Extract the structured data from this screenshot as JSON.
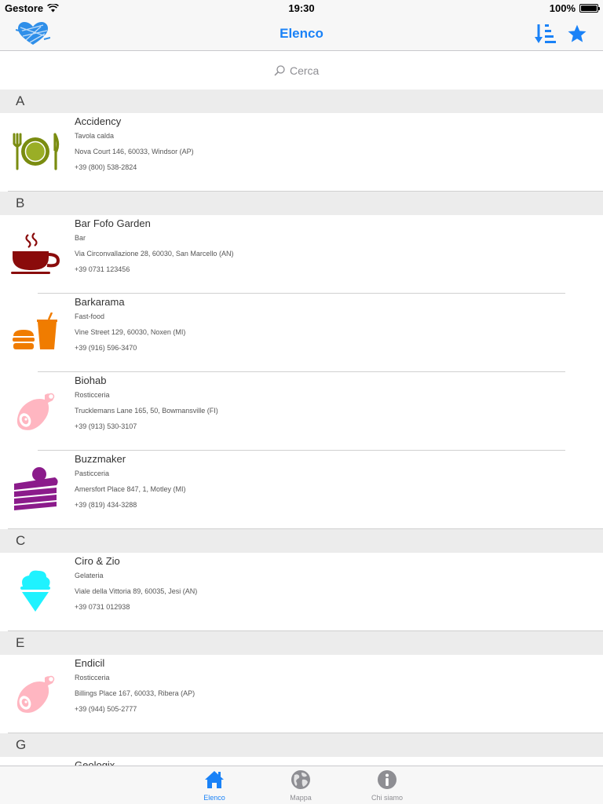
{
  "status_bar": {
    "carrier": "Gestore",
    "time": "19:30",
    "battery": "100%"
  },
  "nav": {
    "title": "Elenco",
    "accent_color": "#1a82f7"
  },
  "search": {
    "placeholder": "Cerca"
  },
  "sections": [
    {
      "letter": "A",
      "rows": [
        {
          "name": "Accidency",
          "category": "Tavola calda",
          "address": "Nova Court 146, 60033, Windsor (AP)",
          "phone": "+39 (800) 538-2824",
          "icon": "plate-cutlery-icon"
        }
      ]
    },
    {
      "letter": "B",
      "rows": [
        {
          "name": "Bar Fofo Garden",
          "category": "Bar",
          "address": "Via Circonvallazione 28, 60030, San Marcello (AN)",
          "phone": "+39 0731 123456",
          "icon": "coffee-cup-icon"
        },
        {
          "name": "Barkarama",
          "category": "Fast-food",
          "address": "Vine Street 129, 60030, Noxen (MI)",
          "phone": "+39 (916) 596-3470",
          "icon": "burger-drink-icon"
        },
        {
          "name": "Biohab",
          "category": "Rosticceria",
          "address": "Trucklemans Lane 165, 50, Bowmansville (FI)",
          "phone": "+39 (913) 530-3107",
          "icon": "ham-icon"
        },
        {
          "name": "Buzzmaker",
          "category": "Pasticceria",
          "address": "Amersfort Place 847, 1, Motley (MI)",
          "phone": "+39 (819) 434-3288",
          "icon": "cake-icon"
        }
      ]
    },
    {
      "letter": "C",
      "rows": [
        {
          "name": "Ciro & Zio",
          "category": "Gelateria",
          "address": "Viale della Vittoria 89, 60035, Jesi (AN)",
          "phone": "+39 0731 012938",
          "icon": "ice-cream-icon"
        }
      ]
    },
    {
      "letter": "E",
      "rows": [
        {
          "name": "Endicil",
          "category": "Rosticceria",
          "address": "Billings Place 167, 60033, Ribera (AP)",
          "phone": "+39 (944) 505-2777",
          "icon": "ham-icon"
        }
      ]
    },
    {
      "letter": "G",
      "rows": [
        {
          "name": "Geologix",
          "category": "",
          "address": "",
          "phone": "",
          "icon": ""
        }
      ]
    }
  ],
  "tabs": [
    {
      "label": "Elenco",
      "icon": "home-icon",
      "active": true
    },
    {
      "label": "Mappa",
      "icon": "globe-icon",
      "active": false
    },
    {
      "label": "Chi siamo",
      "icon": "info-icon",
      "active": false
    }
  ]
}
